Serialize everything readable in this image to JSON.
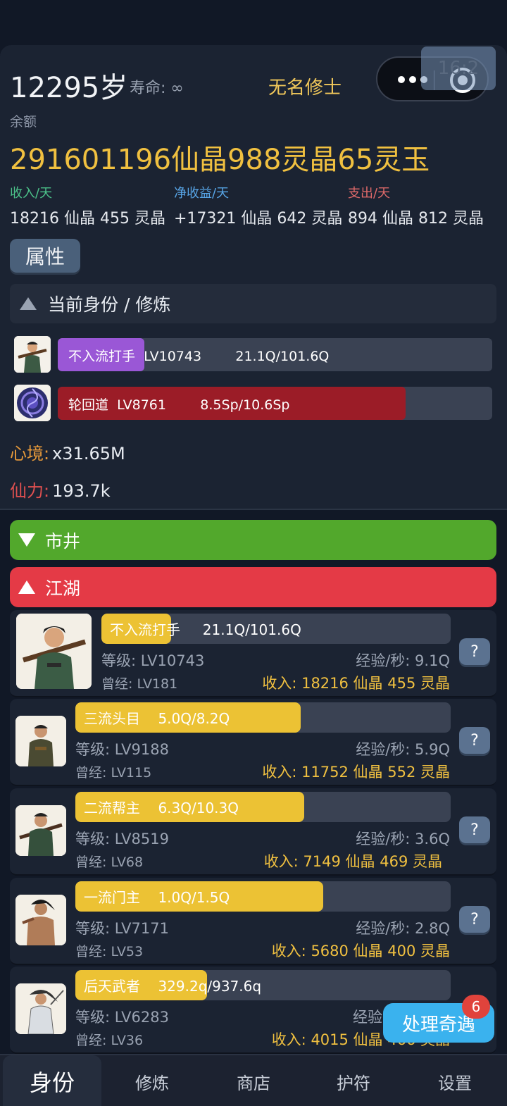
{
  "header": {
    "age": "12295岁",
    "lifespan": "寿命: ∞",
    "player_title": "无名修士",
    "ratio_badge": "16:2",
    "balance_label": "余额",
    "balance": "291601196仙晶988灵晶65灵玉"
  },
  "flows": [
    {
      "label": "收入/天",
      "value": "18216 仙晶 455 灵晶",
      "color": "#4cc38a"
    },
    {
      "label": "净收益/天",
      "value": "+17321 仙晶 642 灵晶",
      "color": "#58a6e8"
    },
    {
      "label": "支出/天",
      "value": "894 仙晶 812 灵晶",
      "color": "#e06a6a"
    }
  ],
  "attr_tab": "属性",
  "current_section": {
    "title": "当前身份 / 修炼",
    "rows": [
      {
        "name": "不入流打手",
        "level": "LV10743",
        "progress_text": "21.1Q/101.6Q",
        "progress": 0.2,
        "color": "#9a57d6"
      },
      {
        "name": "轮回道",
        "level": "LV8761",
        "progress_text": "8.5Sp/10.6Sp",
        "progress": 0.8,
        "color": "#9b1c27"
      }
    ]
  },
  "stats": {
    "mind_label": "心境:",
    "mind_value": "x31.65M",
    "mind_color": "#e89a3a",
    "power_label": "仙力:",
    "power_value": "193.7k",
    "power_color": "#e05050"
  },
  "categories": {
    "market": {
      "label": "市井",
      "color": "#52a82c"
    },
    "jianghu": {
      "label": "江湖",
      "color": "#e43a46"
    }
  },
  "jobs": [
    {
      "name": "不入流打手",
      "progress_text": "21.1Q/101.6Q",
      "progress": 0.2,
      "level": "等级: LV10743",
      "exp": "经验/秒: 9.1Q",
      "past": "曾经: LV181",
      "income": "收入: 18216 仙晶 455 灵晶"
    },
    {
      "name": "三流头目",
      "progress_text": "5.0Q/8.2Q",
      "progress": 0.6,
      "level": "等级: LV9188",
      "exp": "经验/秒: 5.9Q",
      "past": "曾经: LV115",
      "income": "收入: 11752 仙晶 552 灵晶"
    },
    {
      "name": "二流帮主",
      "progress_text": "6.3Q/10.3Q",
      "progress": 0.61,
      "level": "等级: LV8519",
      "exp": "经验/秒: 3.6Q",
      "past": "曾经: LV68",
      "income": "收入: 7149 仙晶 469 灵晶"
    },
    {
      "name": "一流门主",
      "progress_text": "1.0Q/1.5Q",
      "progress": 0.66,
      "level": "等级: LV7171",
      "exp": "经验/秒: 2.8Q",
      "past": "曾经: LV53",
      "income": "收入: 5680 仙晶 400 灵晶"
    },
    {
      "name": "后天武者",
      "progress_text": "329.2q/937.6q",
      "progress": 0.35,
      "level": "等级: LV6283",
      "exp": "经验",
      "past": "曾经: LV36",
      "income": "收入: 4015 仙晶 466 灵晶"
    }
  ],
  "help_label": "?",
  "event": {
    "label": "处理奇遇",
    "count": "6"
  },
  "nav": [
    "身份",
    "修炼",
    "商店",
    "护符",
    "设置"
  ]
}
